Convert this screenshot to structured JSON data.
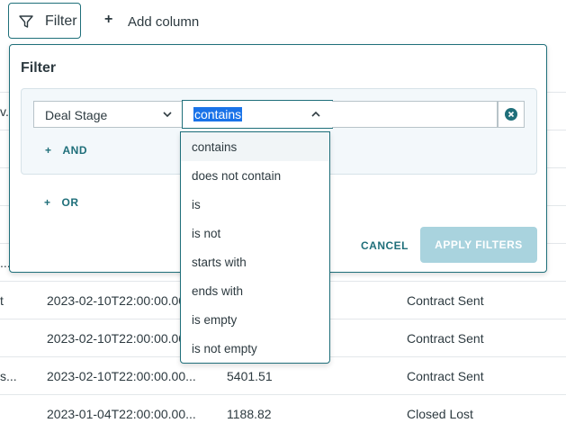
{
  "toolbar": {
    "filter_label": "Filter",
    "add_column_label": "Add column"
  },
  "table": {
    "rows": [
      {
        "c1": "v.",
        "c2": "",
        "c3": "",
        "c4": ""
      },
      {
        "c1": "",
        "c2": "",
        "c3": "",
        "c4": ""
      },
      {
        "c1": "",
        "c2": "",
        "c3": "",
        "c4": ""
      },
      {
        "c1": "",
        "c2": "",
        "c3": "",
        "c4": ""
      },
      {
        "c1": "",
        "c2": "",
        "c3": "",
        "c4": ""
      },
      {
        "c1": "...",
        "c2": "",
        "c3": "",
        "c4": ""
      },
      {
        "c1": "t",
        "c2": "2023-02-10T22:00:00.00...",
        "c3": "",
        "c4": "Contract Sent"
      },
      {
        "c1": "",
        "c2": "2023-02-10T22:00:00.00...",
        "c3": "",
        "c4": "Contract Sent"
      },
      {
        "c1": "s...",
        "c2": "2023-02-10T22:00:00.00...",
        "c3": "5401.51",
        "c4": "Contract Sent"
      },
      {
        "c1": "",
        "c2": "2023-01-04T22:00:00.00...",
        "c3": "1188.82",
        "c4": "Closed Lost"
      }
    ]
  },
  "filter_panel": {
    "title": "Filter",
    "field_value": "Deal Stage",
    "operator_value": "contains",
    "value_input": "",
    "and_label": "AND",
    "or_label": "OR",
    "cancel_label": "CANCEL",
    "apply_label": "APPLY FILTERS",
    "colors": {
      "accent": "#1f6f7a",
      "apply_disabled": "#a9d3de",
      "selection": "#1a73e8"
    }
  },
  "operator_options": [
    "contains",
    "does not contain",
    "is",
    "is not",
    "starts with",
    "ends with",
    "is empty",
    "is not empty"
  ]
}
